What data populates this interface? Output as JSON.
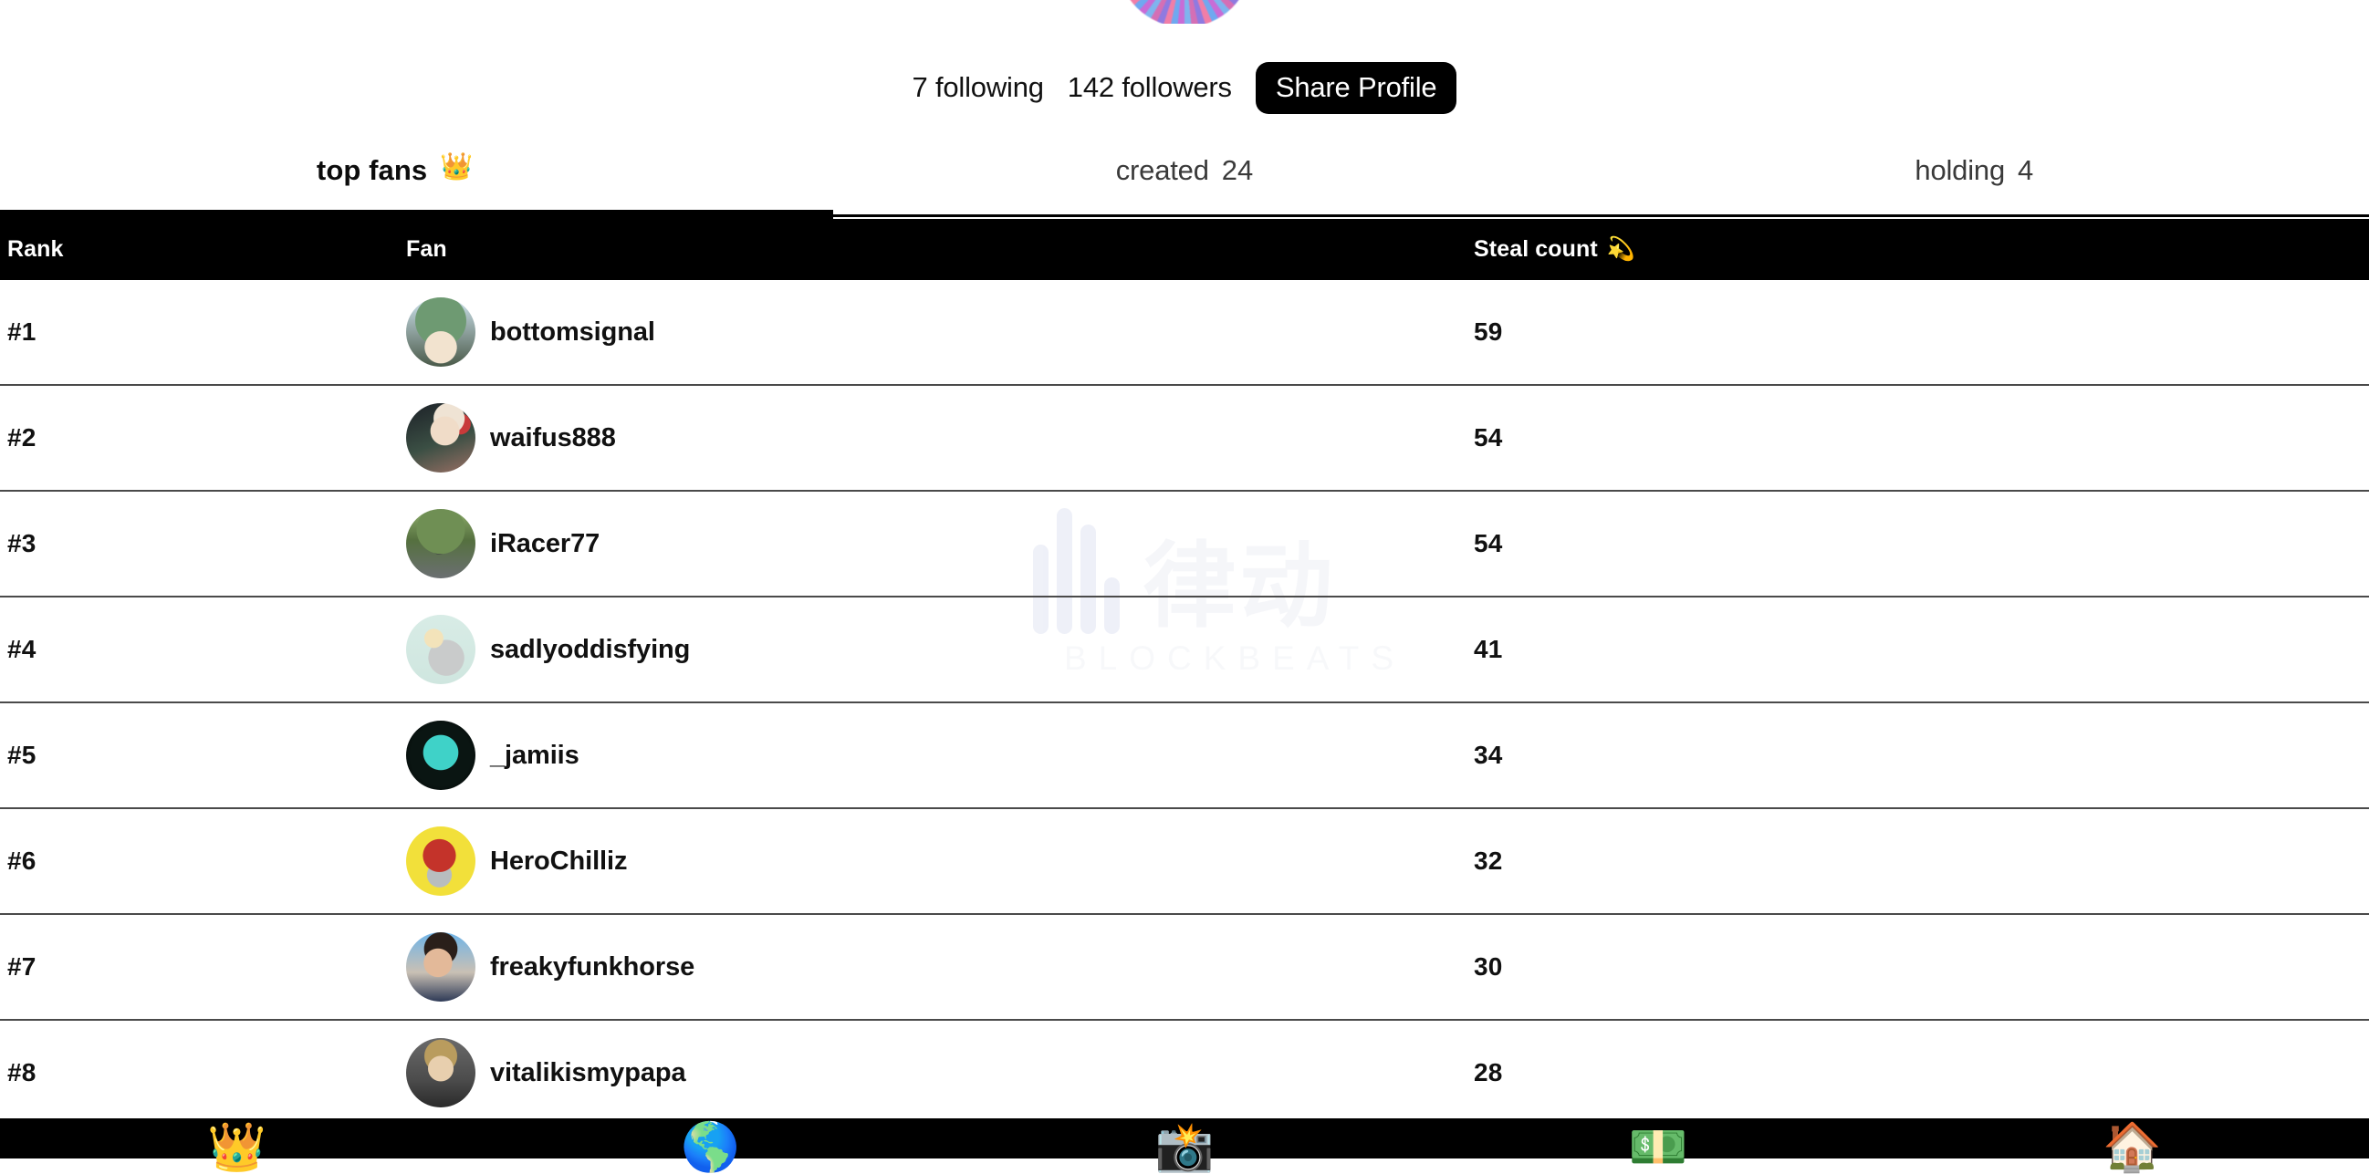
{
  "profile": {
    "avatar": "profile-avatar",
    "following_text": "7 following",
    "followers_text": "142 followers",
    "share_label": "Share Profile"
  },
  "tabs": [
    {
      "label": "top fans",
      "emoji": "👑",
      "emoji_name": "crown-emoji",
      "count": "",
      "active": true
    },
    {
      "label": "created",
      "emoji": "",
      "emoji_name": "",
      "count": "24",
      "active": false
    },
    {
      "label": "holding",
      "emoji": "",
      "emoji_name": "",
      "count": "4",
      "active": false
    }
  ],
  "table": {
    "headers": {
      "rank": "Rank",
      "fan": "Fan",
      "count": "Steal count",
      "count_emoji": "💫",
      "count_emoji_name": "dizzy-emoji"
    },
    "rows": [
      {
        "rank": "#1",
        "name": "bottomsignal",
        "count": "59",
        "avatar": "avatar-bottomsignal"
      },
      {
        "rank": "#2",
        "name": "waifus888",
        "count": "54",
        "avatar": "avatar-waifus888"
      },
      {
        "rank": "#3",
        "name": "iRacer77",
        "count": "54",
        "avatar": "avatar-iracer77"
      },
      {
        "rank": "#4",
        "name": "sadlyoddisfying",
        "count": "41",
        "avatar": "avatar-sadlyoddisfying"
      },
      {
        "rank": "#5",
        "name": "_jamiis",
        "count": "34",
        "avatar": "avatar-jamiis"
      },
      {
        "rank": "#6",
        "name": "HeroChilliz",
        "count": "32",
        "avatar": "avatar-herochilliz"
      },
      {
        "rank": "#7",
        "name": "freakyfunkhorse",
        "count": "30",
        "avatar": "avatar-freakyfunkhorse"
      },
      {
        "rank": "#8",
        "name": "vitalikismypapa",
        "count": "28",
        "avatar": "avatar-vitalikismypapa"
      }
    ]
  },
  "watermark": {
    "cn_text": "律动",
    "sub_text": "BLOCKBEATS"
  },
  "bottom_nav": [
    {
      "emoji": "👑",
      "name": "nav-crown"
    },
    {
      "emoji": "🌎",
      "name": "nav-globe"
    },
    {
      "emoji": "📸",
      "name": "nav-camera"
    },
    {
      "emoji": "💵",
      "name": "nav-money"
    },
    {
      "emoji": "🏠",
      "name": "nav-home"
    }
  ],
  "colors": {
    "accent": "#000000",
    "background": "#ffffff",
    "divider": "#4a4a4a",
    "text": "#111111"
  }
}
